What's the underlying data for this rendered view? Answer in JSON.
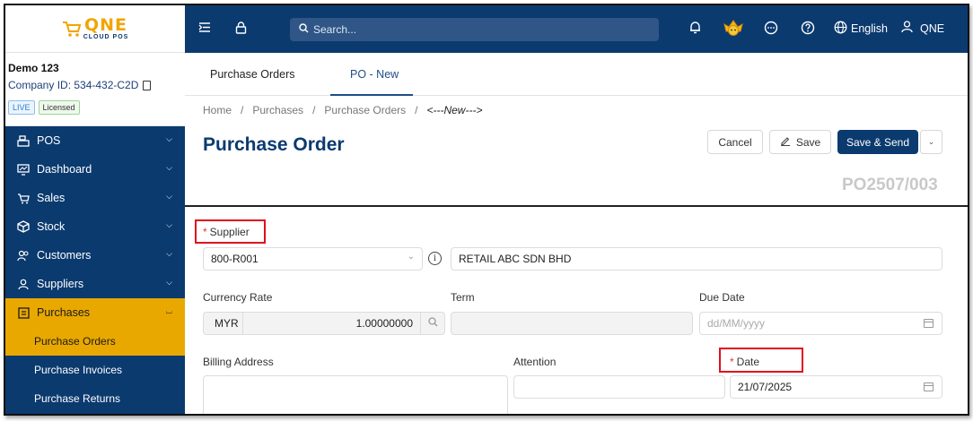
{
  "logo": {
    "main": "QNE",
    "sub": "CLOUD POS"
  },
  "company": {
    "name": "Demo 123",
    "id": "Company ID: 534-432-C2D",
    "badge_live": "LIVE",
    "badge_licensed": "Licensed"
  },
  "menu": {
    "items": [
      {
        "label": "POS"
      },
      {
        "label": "Dashboard"
      },
      {
        "label": "Sales"
      },
      {
        "label": "Stock"
      },
      {
        "label": "Customers"
      },
      {
        "label": "Suppliers"
      },
      {
        "label": "Purchases"
      }
    ],
    "sub_items": [
      {
        "label": "Purchase Orders"
      },
      {
        "label": "Purchase Invoices"
      },
      {
        "label": "Purchase Returns"
      }
    ]
  },
  "topbar": {
    "search_placeholder": "Search...",
    "language": "English",
    "user": "QNE"
  },
  "tabs": [
    {
      "label": "Purchase Orders"
    },
    {
      "label": "PO - New"
    }
  ],
  "breadcrumb": [
    "Home",
    "/",
    "Purchases",
    "/",
    "Purchase Orders",
    "/",
    "<---New--->"
  ],
  "page": {
    "title": "Purchase Order",
    "doc_no": "PO2507/003"
  },
  "buttons": {
    "cancel": "Cancel",
    "save": "Save",
    "save_send": "Save & Send"
  },
  "form": {
    "supplier_label": "Supplier",
    "supplier_code": "800-R001",
    "supplier_name": "RETAIL ABC SDN BHD",
    "currency_rate_label": "Currency Rate",
    "currency": "MYR",
    "rate": "1.00000000",
    "term_label": "Term",
    "term_value": "",
    "due_date_label": "Due Date",
    "due_date_placeholder": "dd/MM/yyyy",
    "billing_address_label": "Billing Address",
    "attention_label": "Attention",
    "date_label": "Date",
    "date_value": "21/07/2025"
  },
  "colors": {
    "primary": "#0b3a6f",
    "accent": "#e9a800",
    "highlight": "#e0101c"
  }
}
